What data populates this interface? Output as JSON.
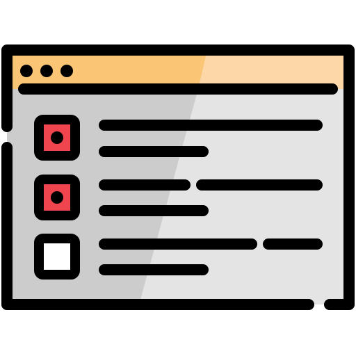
{
  "icon": {
    "name": "checklist-window-icon",
    "window_dots": 3,
    "items": [
      {
        "checked": true
      },
      {
        "checked": true
      },
      {
        "checked": false
      }
    ]
  },
  "colors": {
    "outline": "#000000",
    "titlebar_left": "#FAC574",
    "titlebar_right": "#FDD7A8",
    "body_left": "#CCCCCC",
    "body_right": "#E4E4E4",
    "checkbox_fill": "#F0454F",
    "checkbox_empty": "#FFFFFF"
  }
}
